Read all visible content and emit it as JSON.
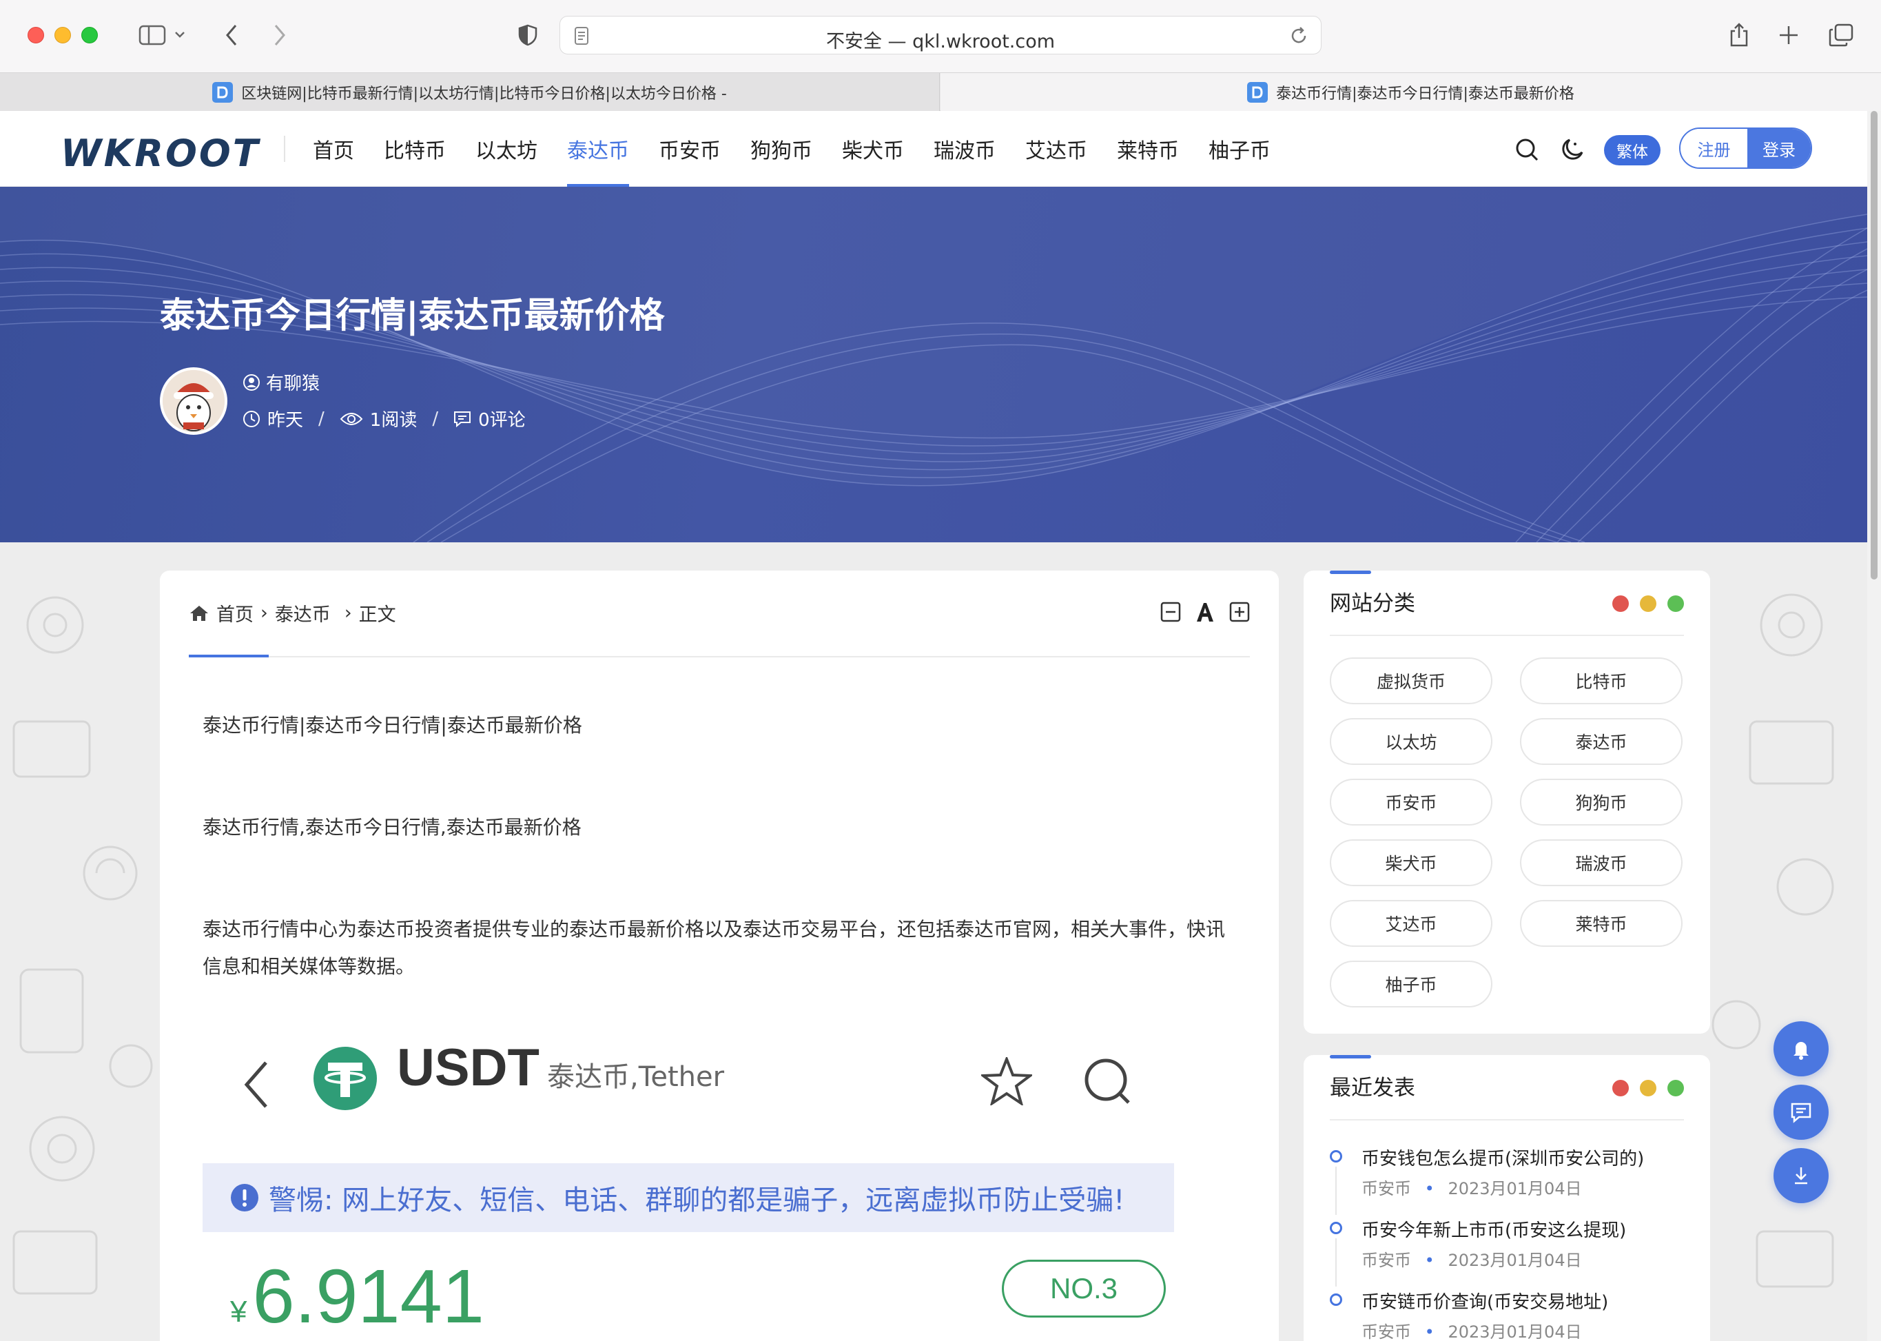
{
  "browser": {
    "url": "不安全 — qkl.wkroot.com",
    "tabs": [
      {
        "title": "区块链网|比特币最新行情|以太坊行情|比特币今日价格|以太坊今日价格 -"
      },
      {
        "title": "泰达币行情|泰达币今日行情|泰达币最新价格"
      }
    ]
  },
  "site": {
    "logo": "WKROOT",
    "nav": [
      "首页",
      "比特币",
      "以太坊",
      "泰达币",
      "币安币",
      "狗狗币",
      "柴犬币",
      "瑞波币",
      "艾达币",
      "莱特币",
      "柚子币"
    ],
    "active_nav": "泰达币",
    "lang_button": "繁体",
    "register": "注册",
    "login": "登录"
  },
  "article": {
    "title": "泰达币今日行情|泰达币最新价格",
    "author": "有聊猿",
    "date": "昨天",
    "reads": "1阅读",
    "comments": "0评论",
    "breadcrumb": [
      "首页",
      "泰达币",
      "正文"
    ],
    "paragraphs": [
      "泰达币行情|泰达币今日行情|泰达币最新价格",
      "泰达币行情,泰达币今日行情,泰达币最新价格",
      "泰达币行情中心为泰达币投资者提供专业的泰达币最新价格以及泰达币交易平台，还包括泰达币官网，相关大事件，快讯信息和相关媒体等数据。"
    ],
    "embed": {
      "coin": "USDT",
      "coin_sub": "泰达币,Tether",
      "warning": "警惕: 网上好友、短信、电话、群聊的都是骗子，远离虚拟币防止受骗!",
      "currency": "¥",
      "price": "6.9141",
      "rank": "NO.3"
    }
  },
  "sidebar": {
    "categories_title": "网站分类",
    "categories": [
      "虚拟货币",
      "比特币",
      "以太坊",
      "泰达币",
      "币安币",
      "狗狗币",
      "柴犬币",
      "瑞波币",
      "艾达币",
      "莱特币",
      "柚子币"
    ],
    "recent_title": "最近发表",
    "recent": [
      {
        "title": "币安钱包怎么提币(深圳币安公司的)",
        "category": "币安币",
        "date": "2023月01月04日"
      },
      {
        "title": "币安今年新上市币(币安这么提现)",
        "category": "币安币",
        "date": "2023月01月04日"
      },
      {
        "title": "币安链币价查询(币安交易地址)",
        "category": "币安币",
        "date": "2023月01月04日"
      }
    ]
  },
  "colors": {
    "accent": "#4574e0",
    "hero": "#3d4fa0",
    "price_green": "#3aa063",
    "dot_red": "#e0554f",
    "dot_yellow": "#e6b83a",
    "dot_green": "#5cbf55"
  }
}
